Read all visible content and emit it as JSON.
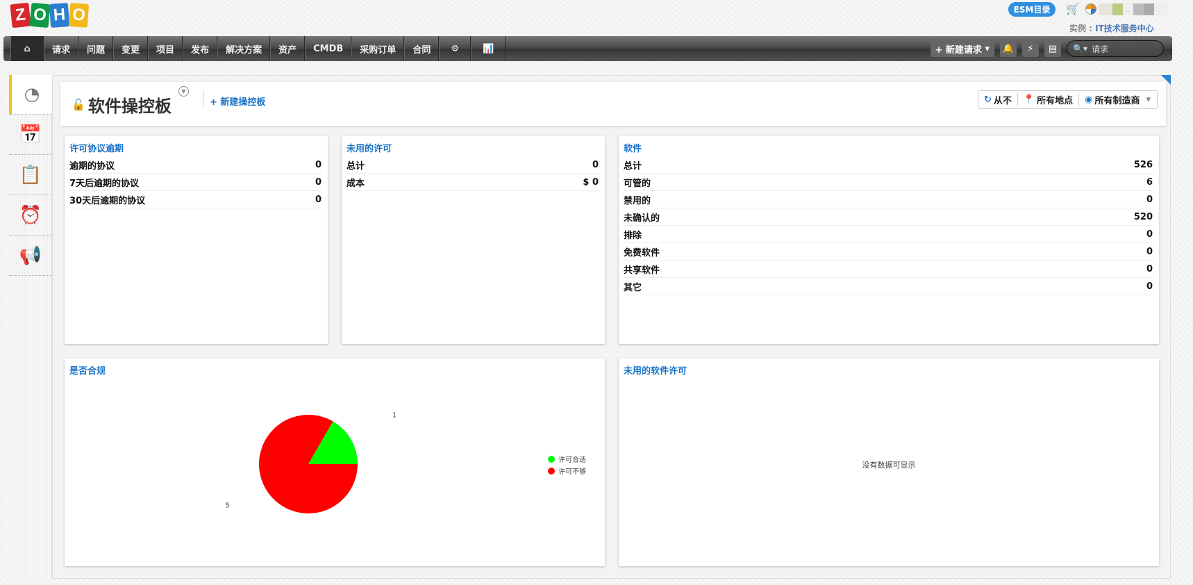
{
  "logo": [
    "Z",
    "O",
    "H",
    "O"
  ],
  "logo_colors": [
    "#d9262c",
    "#109a48",
    "#2a7fd1",
    "#f5b81c"
  ],
  "topbar": {
    "esm": "ESM目录",
    "instance_label": "实例 : ",
    "instance_name": "IT技术服务中心"
  },
  "nav": {
    "items": [
      "请求",
      "问题",
      "变更",
      "项目",
      "发布",
      "解决方案",
      "资产",
      "CMDB",
      "采购订单",
      "合同"
    ],
    "new_request": "+ 新建请求",
    "search_placeholder": "请求"
  },
  "header": {
    "title": "软件操控板",
    "new_dashboard": "+ 新建操控板",
    "filters": {
      "refresh": "从不",
      "location": "所有地点",
      "manufacturer": "所有制造商"
    }
  },
  "widgets": {
    "agreements": {
      "title": "许可协议逾期",
      "rows": [
        {
          "label": "逾期的协议",
          "value": "0"
        },
        {
          "label": "7天后逾期的协议",
          "value": "0"
        },
        {
          "label": "30天后逾期的协议",
          "value": "0"
        }
      ]
    },
    "unused": {
      "title": "未用的许可",
      "rows": [
        {
          "label": "总计",
          "value": "0"
        },
        {
          "label": "成本",
          "value": "$ 0"
        }
      ]
    },
    "software": {
      "title": "软件",
      "rows": [
        {
          "label": "总计",
          "value": "526"
        },
        {
          "label": "可管的",
          "value": "6"
        },
        {
          "label": "禁用的",
          "value": "0"
        },
        {
          "label": "未确认的",
          "value": "520"
        },
        {
          "label": "排除",
          "value": "0"
        },
        {
          "label": "免费软件",
          "value": "0"
        },
        {
          "label": "共享软件",
          "value": "0"
        },
        {
          "label": "其它",
          "value": "0"
        }
      ]
    },
    "compliance": {
      "title": "是否合规"
    },
    "unused_sw": {
      "title": "未用的软件许可",
      "empty": "没有数据可显示"
    }
  },
  "chart_data": {
    "type": "pie",
    "title": "是否合规",
    "slices": [
      {
        "label": "许可合适",
        "value": 1,
        "color": "#00ff00"
      },
      {
        "label": "许可不够",
        "value": 5,
        "color": "#ff0000"
      }
    ],
    "legend": "right"
  }
}
